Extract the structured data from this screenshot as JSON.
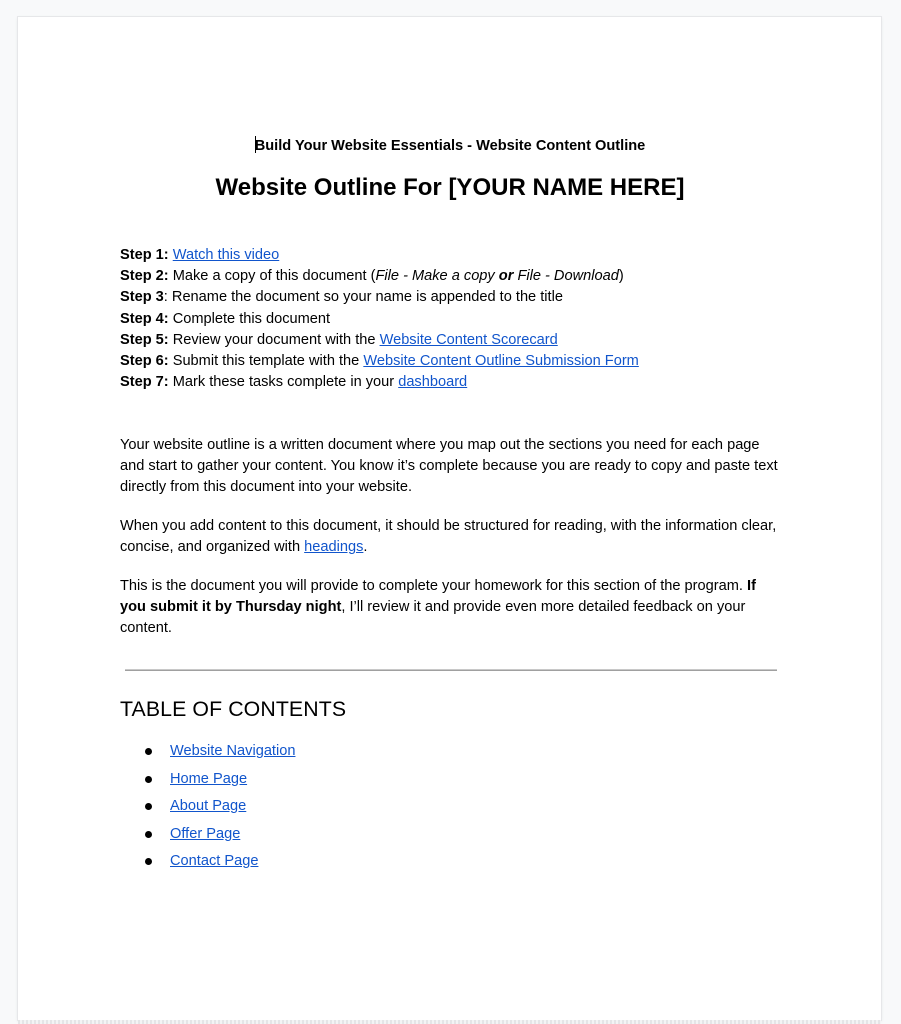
{
  "document": {
    "subtitle": "Build Your Website Essentials - Website Content Outline",
    "title": "Website Outline For [YOUR NAME HERE]",
    "link_color": "#1155cc",
    "steps": [
      {
        "label": "Step 1:",
        "text_before": " ",
        "link": "Watch this video",
        "text_after": ""
      },
      {
        "label": "Step 2:",
        "text_before": " Make a copy of this document (",
        "italic1": "File - Make a copy",
        "bold_or": " or ",
        "italic2": "File - Download",
        "text_after": ")"
      },
      {
        "label": "Step 3",
        "text_before": ": Rename the document so your name is appended to the title"
      },
      {
        "label": "Step 4:",
        "text_before": " Complete this document"
      },
      {
        "label": "Step 5:",
        "text_before": " Review your document with the ",
        "link": "Website Content Scorecard"
      },
      {
        "label": "Step 6:",
        "text_before": " Submit this template with the ",
        "link": "Website Content Outline Submission Form"
      },
      {
        "label": "Step 7:",
        "text_before": " Mark these tasks complete in your ",
        "link": "dashboard"
      }
    ],
    "paragraphs": {
      "p1": "Your website outline is a written document where you map out the sections you need for each page and start to gather your content. You know it’s complete because you are ready to copy and paste text directly from this document into your website.",
      "p2_before": "When you add content to this document, it should be structured for reading, with the information clear, concise, and organized with ",
      "p2_link": "headings",
      "p2_after": ".",
      "p3_before": "This is the document you will provide to complete your homework for this section of the program. ",
      "p3_bold": "If you submit it by Thursday night",
      "p3_after": ", I’ll review it and provide even more detailed feedback on your content."
    },
    "toc": {
      "heading": "TABLE OF CONTENTS",
      "items": [
        {
          "label": "Website Navigation"
        },
        {
          "label": "Home Page"
        },
        {
          "label": "About Page"
        },
        {
          "label": "Offer Page"
        },
        {
          "label": "Contact Page"
        }
      ]
    }
  }
}
